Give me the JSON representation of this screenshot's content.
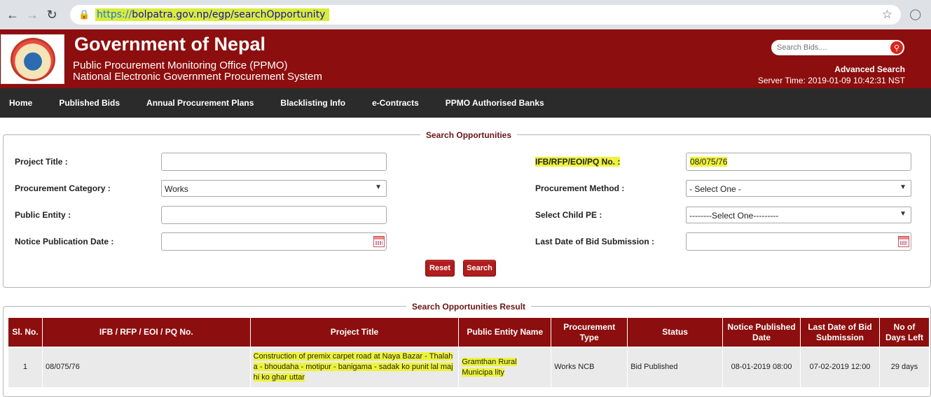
{
  "browser": {
    "url_scheme": "https://",
    "url_rest": "bolpatra.gov.np/egp/searchOpportunity"
  },
  "header": {
    "title": "Government of Nepal",
    "subtitle1": "Public Procurement Monitoring Office (PPMO)",
    "subtitle2": "National Electronic Government Procurement System",
    "search_placeholder": "Search Bids....",
    "advanced_search": "Advanced Search",
    "server_time": "Server Time: 2019-01-09 10:42:31 NST"
  },
  "menu": {
    "items": [
      {
        "label": "Home"
      },
      {
        "label": "Published Bids"
      },
      {
        "label": "Annual Procurement Plans"
      },
      {
        "label": "Blacklisting Info"
      },
      {
        "label": "e-Contracts"
      },
      {
        "label": "PPMO Authorised Banks"
      }
    ]
  },
  "search_form": {
    "legend": "Search Opportunities",
    "project_title_label": "Project Title :",
    "project_title_value": "",
    "procurement_category_label": "Procurement Category :",
    "procurement_category_value": "Works",
    "public_entity_label": "Public Entity :",
    "public_entity_value": "",
    "notice_date_label": "Notice Publication Date :",
    "notice_date_value": "",
    "ifb_label": "IFB/RFP/EOI/PQ No. :",
    "ifb_value": "08/075/76",
    "procurement_method_label": "Procurement Method :",
    "procurement_method_value": "- Select One -",
    "child_pe_label": "Select Child PE :",
    "child_pe_value": "--------Select One---------",
    "last_date_label": "Last Date of Bid Submission :",
    "last_date_value": "",
    "reset_label": "Reset",
    "search_label": "Search"
  },
  "results": {
    "legend": "Search Opportunities Result",
    "columns": [
      "Sl. No.",
      "IFB / RFP / EOI / PQ No.",
      "Project Title",
      "Public Entity Name",
      "Procurement Type",
      "Status",
      "Notice Published Date",
      "Last Date of Bid Submission",
      "No of Days Left"
    ],
    "rows": [
      {
        "sl": "1",
        "ifb": "08/075/76",
        "title": "Construction of premix carpet road at Naya Bazar - Thalah a - bhoudaha - motipur - banigama - sadak ko punit lal maj hi ko ghar uttar",
        "entity": "Gramthan Rural Municipa lity",
        "type": "Works NCB",
        "status": "Bid Published",
        "published": "08-01-2019 08:00",
        "last_date": "07-02-2019 12:00",
        "days_left": "29 days"
      }
    ]
  }
}
